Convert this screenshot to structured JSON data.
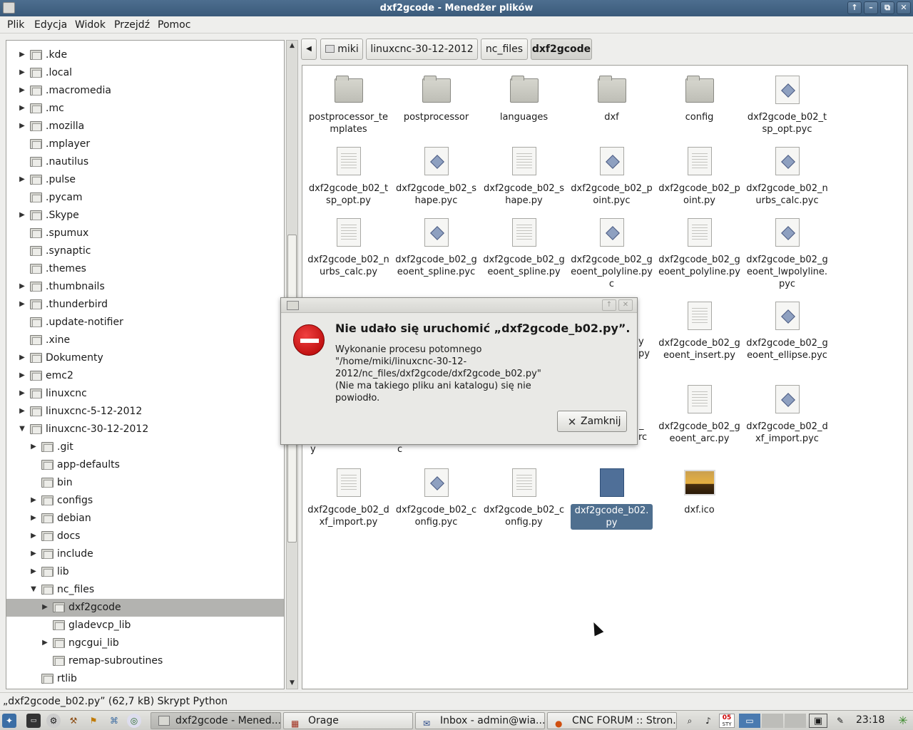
{
  "window": {
    "title": "dxf2gcode - Menedżer plików",
    "buttons": [
      "↑",
      "–",
      "⧉",
      "✕"
    ]
  },
  "menubar": {
    "items": [
      "Plik",
      "Edycja",
      "Widok",
      "Przejdź",
      "Pomoc"
    ]
  },
  "sidebar": {
    "items": [
      {
        "label": ".kde",
        "depth": 0,
        "expander": "▶"
      },
      {
        "label": ".local",
        "depth": 0,
        "expander": "▶"
      },
      {
        "label": ".macromedia",
        "depth": 0,
        "expander": "▶"
      },
      {
        "label": ".mc",
        "depth": 0,
        "expander": "▶"
      },
      {
        "label": ".mozilla",
        "depth": 0,
        "expander": "▶"
      },
      {
        "label": ".mplayer",
        "depth": 0,
        "expander": ""
      },
      {
        "label": ".nautilus",
        "depth": 0,
        "expander": ""
      },
      {
        "label": ".pulse",
        "depth": 0,
        "expander": "▶"
      },
      {
        "label": ".pycam",
        "depth": 0,
        "expander": ""
      },
      {
        "label": ".Skype",
        "depth": 0,
        "expander": "▶"
      },
      {
        "label": ".spumux",
        "depth": 0,
        "expander": ""
      },
      {
        "label": ".synaptic",
        "depth": 0,
        "expander": ""
      },
      {
        "label": ".themes",
        "depth": 0,
        "expander": ""
      },
      {
        "label": ".thumbnails",
        "depth": 0,
        "expander": "▶"
      },
      {
        "label": ".thunderbird",
        "depth": 0,
        "expander": "▶"
      },
      {
        "label": ".update-notifier",
        "depth": 0,
        "expander": ""
      },
      {
        "label": ".xine",
        "depth": 0,
        "expander": ""
      },
      {
        "label": "Dokumenty",
        "depth": 0,
        "expander": "▶"
      },
      {
        "label": "emc2",
        "depth": 0,
        "expander": "▶"
      },
      {
        "label": "linuxcnc",
        "depth": 0,
        "expander": "▶"
      },
      {
        "label": "linuxcnc-5-12-2012",
        "depth": 0,
        "expander": "▶"
      },
      {
        "label": "linuxcnc-30-12-2012",
        "depth": 0,
        "expander": "▼"
      },
      {
        "label": ".git",
        "depth": 1,
        "expander": "▶"
      },
      {
        "label": "app-defaults",
        "depth": 1,
        "expander": ""
      },
      {
        "label": "bin",
        "depth": 1,
        "expander": ""
      },
      {
        "label": "configs",
        "depth": 1,
        "expander": "▶"
      },
      {
        "label": "debian",
        "depth": 1,
        "expander": "▶"
      },
      {
        "label": "docs",
        "depth": 1,
        "expander": "▶"
      },
      {
        "label": "include",
        "depth": 1,
        "expander": "▶"
      },
      {
        "label": "lib",
        "depth": 1,
        "expander": "▶"
      },
      {
        "label": "nc_files",
        "depth": 1,
        "expander": "▼"
      },
      {
        "label": "dxf2gcode",
        "depth": 2,
        "expander": "▶",
        "selected": true
      },
      {
        "label": "gladevcp_lib",
        "depth": 2,
        "expander": ""
      },
      {
        "label": "ngcgui_lib",
        "depth": 2,
        "expander": "▶"
      },
      {
        "label": "remap-subroutines",
        "depth": 2,
        "expander": ""
      },
      {
        "label": "rtlib",
        "depth": 1,
        "expander": ""
      }
    ]
  },
  "pathbar": {
    "back_arrow": "◀",
    "crumbs": [
      "miki",
      "linuxcnc-30-12-2012",
      "nc_files",
      "dxf2gcode"
    ]
  },
  "files": [
    {
      "name": "postprocessor_templates",
      "type": "folder"
    },
    {
      "name": "postprocessor",
      "type": "folder"
    },
    {
      "name": "languages",
      "type": "folder"
    },
    {
      "name": "dxf",
      "type": "folder"
    },
    {
      "name": "config",
      "type": "folder"
    },
    {
      "name": "dxf2gcode_b02_tsp_opt.pyc",
      "type": "pyc"
    },
    {
      "name": "dxf2gcode_b02_tsp_opt.py",
      "type": "doc"
    },
    {
      "name": "dxf2gcode_b02_shape.pyc",
      "type": "pyc"
    },
    {
      "name": "dxf2gcode_b02_shape.py",
      "type": "doc"
    },
    {
      "name": "dxf2gcode_b02_point.pyc",
      "type": "pyc"
    },
    {
      "name": "dxf2gcode_b02_point.py",
      "type": "doc"
    },
    {
      "name": "dxf2gcode_b02_nurbs_calc.pyc",
      "type": "pyc"
    },
    {
      "name": "dxf2gcode_b02_nurbs_calc.py",
      "type": "doc"
    },
    {
      "name": "dxf2gcode_b02_geoent_spline.pyc",
      "type": "pyc"
    },
    {
      "name": "dxf2gcode_b02_geoent_spline.py",
      "type": "doc"
    },
    {
      "name": "dxf2gcode_b02_geoent_polyline.pyc",
      "type": "pyc"
    },
    {
      "name": "dxf2gcode_b02_geoent_polyline.py",
      "type": "doc"
    },
    {
      "name": "dxf2gcode_b02_geoent_lwpolyline.pyc",
      "type": "pyc"
    },
    {
      "name": "dxf2gcode_b02_geoent_insert.py",
      "type": "doc"
    },
    {
      "name": "dxf2gcode_b02_geoent_ellipse.pyc",
      "type": "pyc"
    },
    {
      "name": "dxf2gcode_b02_geoent_arc.py",
      "type": "doc"
    },
    {
      "name": "dxf2gcode_b02_dxf_import.pyc",
      "type": "pyc"
    },
    {
      "name": "dxf2gcode_b02_dxf_import.py",
      "type": "doc"
    },
    {
      "name": "dxf2gcode_b02_config.pyc",
      "type": "pyc"
    },
    {
      "name": "dxf2gcode_b02_config.py",
      "type": "doc"
    },
    {
      "name": "dxf2gcode_b02.py",
      "type": "py-selected",
      "selected": true
    },
    {
      "name": "dxf.ico",
      "type": "image"
    }
  ],
  "partial_labels": {
    "row4_col5": "y",
    "row4_col6": "py",
    "row5_col1": "y",
    "row5_col2": "c",
    "row5_col6a": "_",
    "row5_col6b": "rc"
  },
  "dialog": {
    "heading": "Nie udało się uruchomić „dxf2gcode_b02.py”.",
    "message": "Wykonanie procesu potomnego \"/home/miki/linuxcnc-30-12-2012/nc_files/dxf2gcode/dxf2gcode_b02.py\" (Nie ma takiego pliku ani katalogu) się nie powiodło.",
    "close_label": "Zamknij",
    "title_buttons": [
      "↑",
      "✕"
    ]
  },
  "statusbar": {
    "text": "„dxf2gcode_b02.py” (62,7 kB) Skrypt Python"
  },
  "taskbar": {
    "tasks": [
      {
        "label": "dxf2gcode - Mened...",
        "active": true
      },
      {
        "label": "Orage",
        "active": false
      },
      {
        "label": "Inbox - admin@wia...",
        "active": false
      },
      {
        "label": "CNC FORUM :: Stron...",
        "active": false
      }
    ],
    "calendar_day": "05",
    "calendar_month": "STY",
    "clock": "23:18"
  },
  "colors": {
    "titlebar": "#3a5a7a",
    "selection": "#4f6f8f",
    "error_icon": "#c00000"
  }
}
